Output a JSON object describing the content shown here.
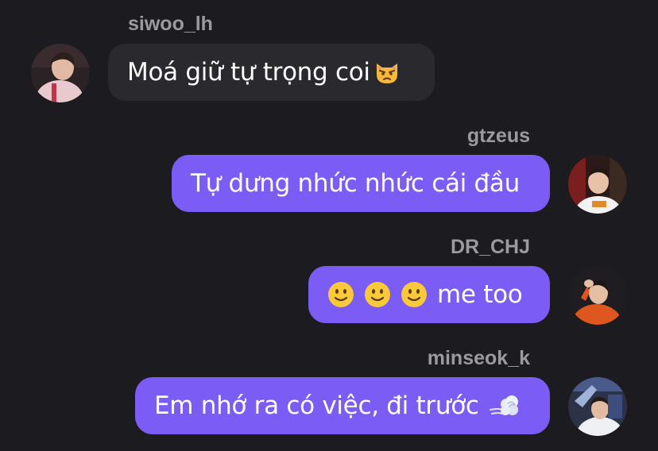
{
  "messages": [
    {
      "username": "siwoo_lh",
      "text": "Moá giữ tự trọng coi",
      "emoji": "pouting-cat-icon",
      "direction": "incoming"
    },
    {
      "username": "gtzeus",
      "text": "Tự dưng nhức nhức cái đầu",
      "direction": "outgoing"
    },
    {
      "username": "DR_CHJ",
      "emoji": [
        "slightly-smiling-face-icon",
        "slightly-smiling-face-icon",
        "slightly-smiling-face-icon"
      ],
      "text": "me too",
      "direction": "outgoing"
    },
    {
      "username": "minseok_k",
      "text": "Em nhớ ra có việc, đi trước",
      "emoji": "dashing-away-icon",
      "direction": "outgoing"
    }
  ],
  "colors": {
    "background": "#1c1b1f",
    "incoming_bubble": "#2a2a2e",
    "outgoing_bubble": "#7b5cf5",
    "username": "#9c9aa0",
    "message_text": "#ffffff"
  }
}
